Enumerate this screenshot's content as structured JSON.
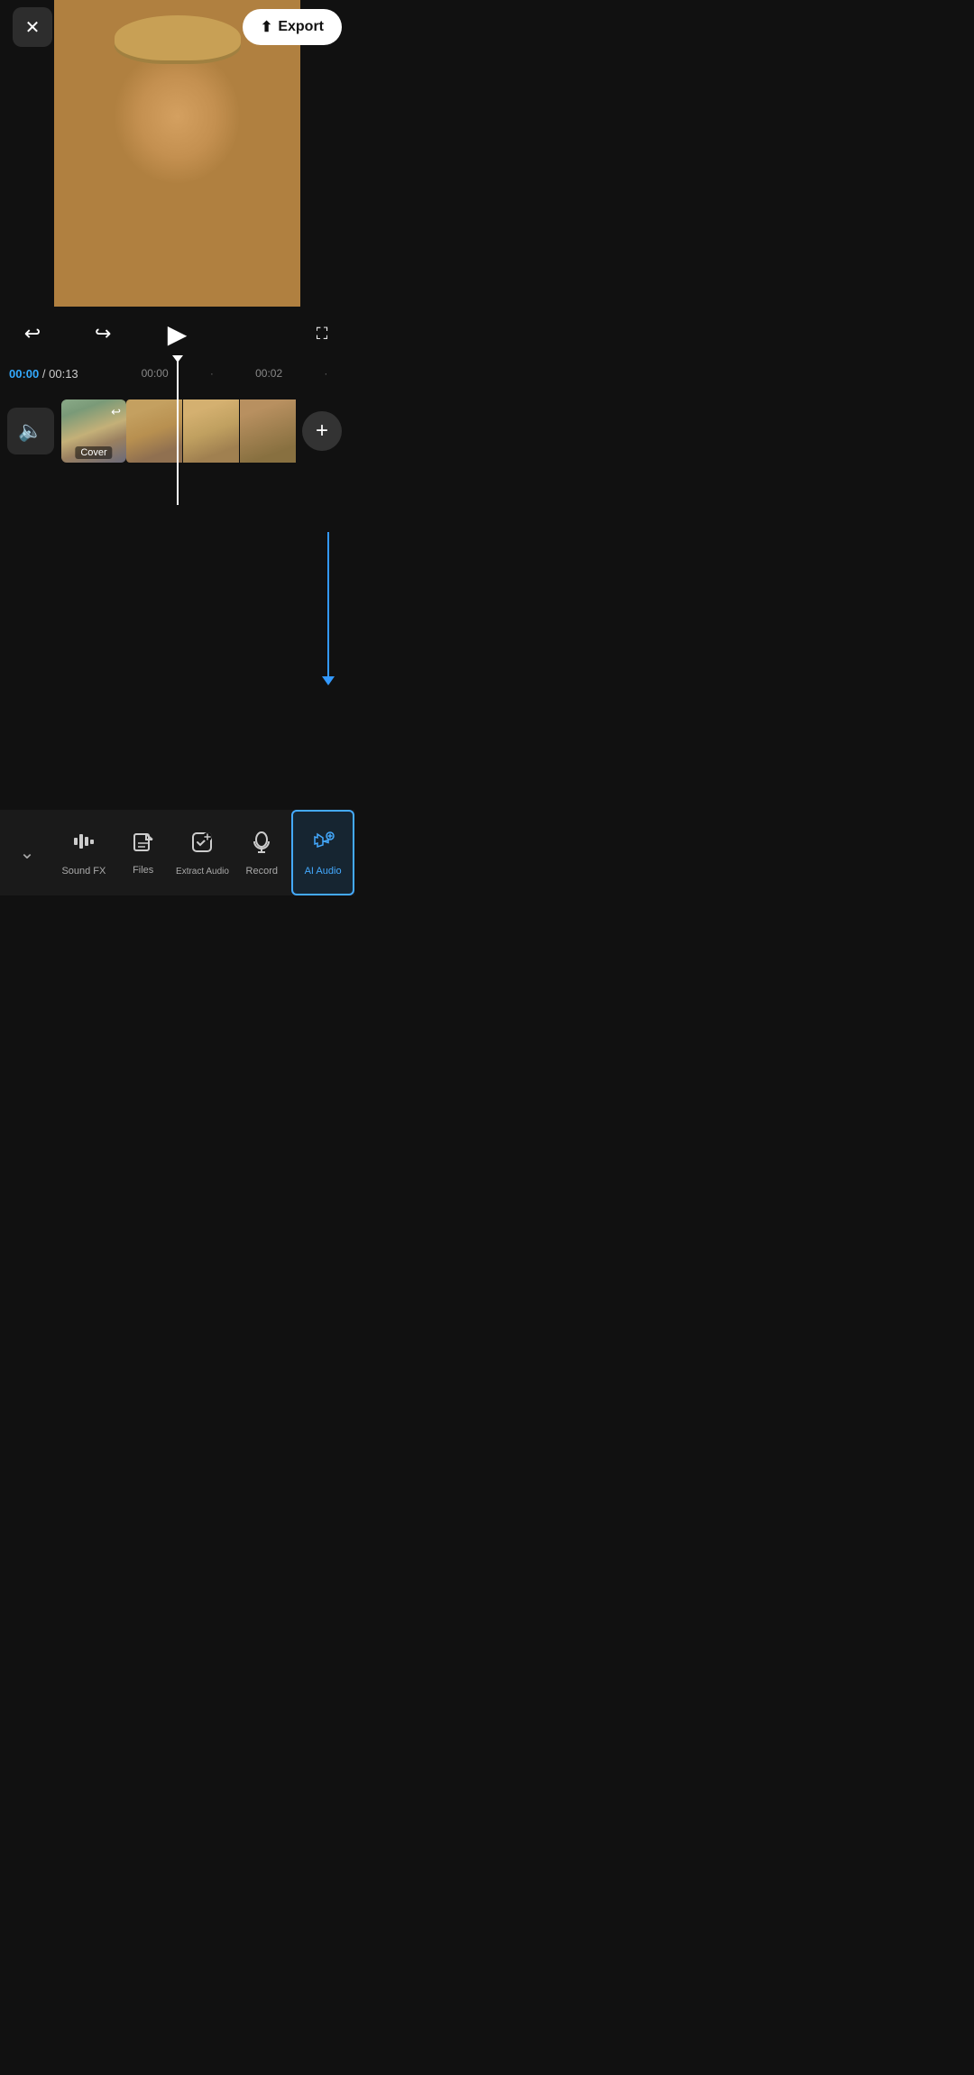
{
  "header": {
    "close_label": "×",
    "export_label": "Export"
  },
  "controls": {
    "undo_label": "↩",
    "redo_label": "↪",
    "play_label": "▶",
    "fullscreen_label": "⛶"
  },
  "timeline": {
    "current_time": "00:00",
    "total_time": "00:13",
    "separator": "/",
    "marker1": "00:00",
    "marker2": "00:02"
  },
  "track": {
    "sound_icon": "🔊",
    "cover_label": "Cover",
    "add_label": "+"
  },
  "toolbar": {
    "collapse_icon": "chevron",
    "items": [
      {
        "id": "sound-fx",
        "label": "Sound FX",
        "icon": "sound-fx"
      },
      {
        "id": "files",
        "label": "Files",
        "icon": "files"
      },
      {
        "id": "extract-audio",
        "label": "Extract\nAudio",
        "icon": "extract-audio"
      },
      {
        "id": "record",
        "label": "Record",
        "icon": "record"
      },
      {
        "id": "ai-audio",
        "label": "AI Audio",
        "icon": "ai-audio",
        "active": true
      }
    ]
  }
}
